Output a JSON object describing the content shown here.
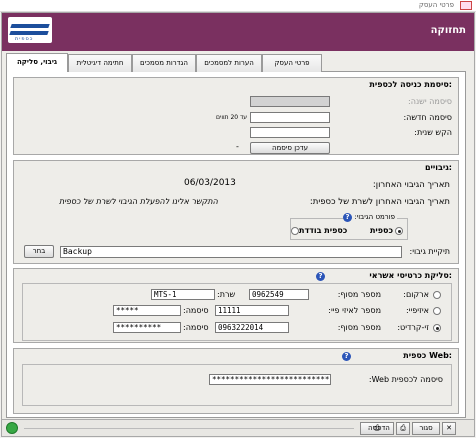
{
  "window": {
    "title": "פרטי העסק"
  },
  "header": {
    "title": "תחזוקה",
    "logo_text": "כספית"
  },
  "tabs": [
    {
      "label": "פרטי העסק"
    },
    {
      "label": "הערות למסמכים"
    },
    {
      "label": "הגדרות מסמכים"
    },
    {
      "label": "חתימה דיגיטלית"
    },
    {
      "label": "גיבוי, סליקה"
    }
  ],
  "password": {
    "title": "סיסמת כניסה לכספית:",
    "old_label": "סיסמה ישנה:",
    "new_label": "סיסמה חדשה:",
    "new_hint": "עד 20 תווים",
    "repeat_label": "הקש שנית:",
    "update_button": "עדכן סיסמה",
    "dash": "-"
  },
  "backup": {
    "title": "גיבויים:",
    "last_date_label": "תאריך הגיבוי האחרון:",
    "last_date_value": "06/03/2013",
    "last_sent_label": "תאריך הגיבוי האחרון לשרת של כספית:",
    "last_sent_value": "התקשר אלינו להפעלת הגיבוי לשרת של כספית",
    "format_label": "פורמט הגיבוי:",
    "format_opt1": "כספית",
    "format_opt2": "כספית בודדת",
    "folder_label": "תיקיית גיבוי:",
    "folder_value": "Backup",
    "choose_button": "בחר"
  },
  "cards": {
    "title": "סליקת כרטיסי אשראי:",
    "rows": [
      {
        "name": "ארקום:",
        "f1_label": "מספר מסוף:",
        "f1_value": "0962549",
        "f2_label": "שרת:",
        "f2_value": "MTS-1"
      },
      {
        "name": "איזיפיי:",
        "f1_label": "מספר לאיזי פיי:",
        "f1_value": "11111",
        "f2_label": "סיסמה:",
        "f2_value": "*****"
      },
      {
        "name": "זי-קרדיט:",
        "f1_label": "מספר מסוף:",
        "f1_value": "0963222014",
        "f2_label": "סיסמה:",
        "f2_value": "**********"
      }
    ]
  },
  "web": {
    "title": "כספית Web:",
    "pwd_label": "סיסמה לכספית Web:",
    "pwd_value": "**********************************"
  },
  "footer": {
    "close_label": "סגור",
    "print_label": "הדפסה"
  },
  "colors": {
    "header_bg": "#7a3060",
    "panel_bg": "#eeede9",
    "help_icon": "#2b55b8"
  }
}
